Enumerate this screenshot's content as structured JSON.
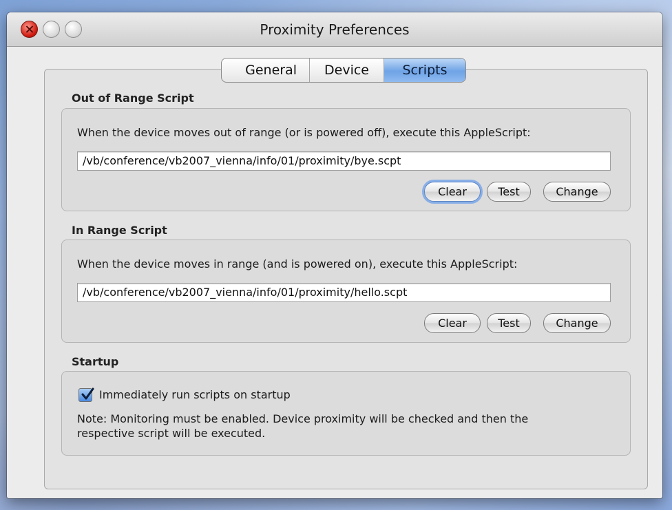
{
  "window": {
    "title": "Proximity Preferences"
  },
  "tabs": [
    {
      "label": "General",
      "active": false
    },
    {
      "label": "Device",
      "active": false
    },
    {
      "label": "Scripts",
      "active": true
    }
  ],
  "out_of_range": {
    "title": "Out of Range Script",
    "description": "When the device moves out of range (or is powered off), execute this AppleScript:",
    "path": "/vb/conference/vb2007_vienna/info/01/proximity/bye.scpt",
    "clear_label": "Clear",
    "test_label": "Test",
    "change_label": "Change"
  },
  "in_range": {
    "title": "In Range Script",
    "description": "When the device moves in range (and is powered on), execute this AppleScript:",
    "path": "/vb/conference/vb2007_vienna/info/01/proximity/hello.scpt",
    "clear_label": "Clear",
    "test_label": "Test",
    "change_label": "Change"
  },
  "startup": {
    "title": "Startup",
    "checkbox_label": "Immediately run scripts on startup",
    "checked": true,
    "note_line1": "Note: Monitoring must be enabled. Device proximity will be checked and then the",
    "note_line2": "respective script will be executed."
  },
  "colors": {
    "tab_active": "#6fa3e6",
    "close_button": "#d01a0f",
    "focus_ring": "#6ea0eb"
  },
  "icons": [
    "close-icon",
    "minimize-icon",
    "zoom-icon",
    "checkmark-icon"
  ]
}
